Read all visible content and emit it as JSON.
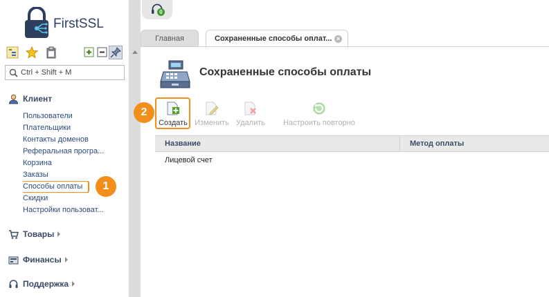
{
  "brand": {
    "name": "FirstSSL"
  },
  "sidebar": {
    "toolbar": [
      {
        "icon": "tree-view-icon"
      },
      {
        "icon": "star-icon"
      },
      {
        "icon": "clipboard-icon"
      },
      {
        "icon": "expand-all-icon"
      },
      {
        "icon": "collapse-all-icon"
      },
      {
        "icon": "pin-icon"
      }
    ],
    "search": {
      "placeholder": "Ctrl + Shift + M"
    },
    "sections": [
      {
        "label": "Клиент",
        "icon": "client-icon",
        "expanded": true,
        "items": [
          {
            "label": "Пользователи"
          },
          {
            "label": "Плательщики"
          },
          {
            "label": "Контакты доменов"
          },
          {
            "label": "Реферальная програ..."
          },
          {
            "label": "Корзина"
          },
          {
            "label": "Заказы"
          },
          {
            "label": "Способы оплаты",
            "active": true
          },
          {
            "label": "Скидки"
          },
          {
            "label": "Настройки пользоват..."
          }
        ]
      },
      {
        "label": "Товары",
        "icon": "cart-icon",
        "expanded": false
      },
      {
        "label": "Финансы",
        "icon": "finance-icon",
        "expanded": false
      },
      {
        "label": "Поддержка",
        "icon": "headset-icon",
        "expanded": false
      }
    ]
  },
  "tabs": [
    {
      "label": "Главная",
      "active": false
    },
    {
      "label": "Сохраненные способы оплат...",
      "active": true
    }
  ],
  "support": {
    "count": "0"
  },
  "page": {
    "title": "Сохраненные способы оплаты"
  },
  "toolbar": {
    "create": "Создать",
    "edit": "Изменить",
    "delete": "Удалить",
    "reconfigure": "Настроить повторно"
  },
  "grid": {
    "columns": [
      "Название",
      "Метод оплаты"
    ],
    "rows": [
      {
        "name": "Лицевой счет",
        "method": ""
      }
    ]
  },
  "callouts": [
    "1",
    "2"
  ],
  "colors": {
    "accent": "#f28e1c",
    "link": "#2b4a7a",
    "heading": "#3a4b66"
  }
}
